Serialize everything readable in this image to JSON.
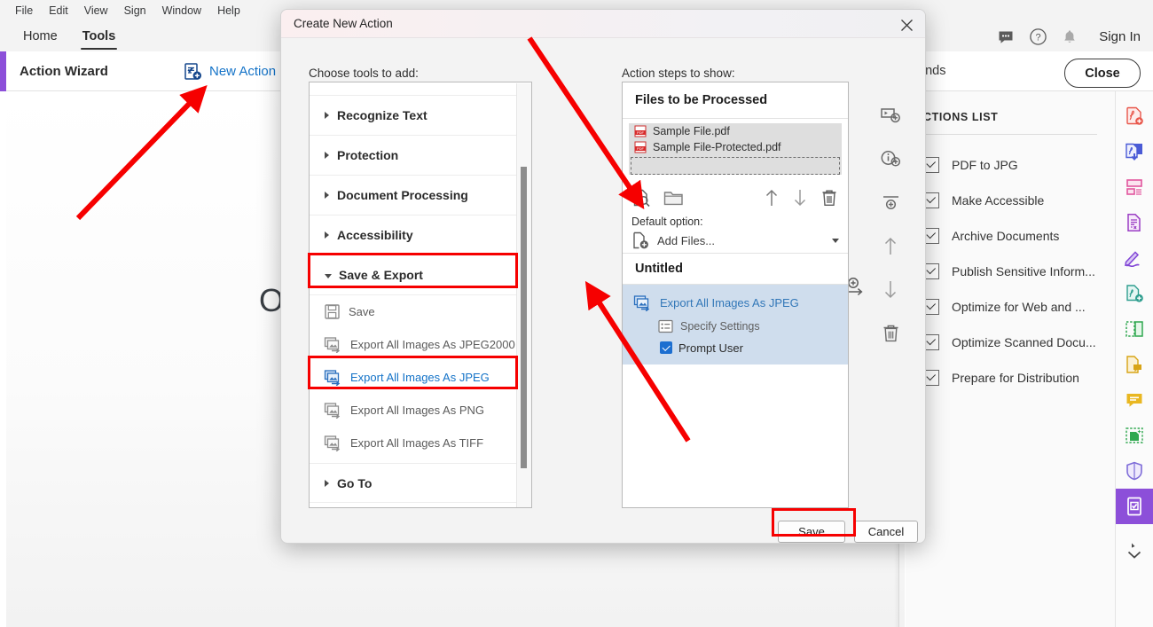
{
  "menubar": {
    "items": [
      "File",
      "Edit",
      "View",
      "Sign",
      "Window",
      "Help"
    ]
  },
  "tabs": [
    {
      "label": "Home",
      "active": false
    },
    {
      "label": "Tools",
      "active": true
    }
  ],
  "topright": {
    "comment_icon": "comment-icon",
    "help_icon": "help-icon",
    "bell_icon": "notifications-icon",
    "signin_label": "Sign In"
  },
  "command_strip": {
    "tool_title": "Action Wizard",
    "new_action_label": "New Action",
    "new_action_icon": "new-action-icon",
    "commands_text": "ands",
    "close_label": "Close"
  },
  "document": {
    "visible_text": "Op"
  },
  "actions_panel": {
    "heading": "CTIONS LIST",
    "items": [
      {
        "label": "PDF to JPG",
        "checked": true
      },
      {
        "label": "Make Accessible",
        "checked": true
      },
      {
        "label": "Archive Documents",
        "checked": true
      },
      {
        "label": "Publish Sensitive Inform...",
        "checked": true
      },
      {
        "label": "Optimize for Web and ...",
        "checked": true
      },
      {
        "label": "Optimize Scanned Docu...",
        "checked": true
      },
      {
        "label": "Prepare for Distribution",
        "checked": true
      }
    ]
  },
  "right_rail": {
    "items": [
      {
        "icon": "create-pdf-icon",
        "color": "#e8564a",
        "selected": false
      },
      {
        "icon": "export-pdf-icon",
        "color": "#4a5bd6",
        "selected": false
      },
      {
        "icon": "organize-pages-icon",
        "color": "#e2569e",
        "selected": false
      },
      {
        "icon": "edit-pdf-icon",
        "color": "#9b3fc4",
        "selected": false
      },
      {
        "icon": "fill-and-sign-icon",
        "color": "#8246d6",
        "selected": false
      },
      {
        "icon": "create-pdf-green-icon",
        "color": "#2f9e8f",
        "selected": false
      },
      {
        "icon": "compare-files-icon",
        "color": "#2fa84f",
        "selected": false
      },
      {
        "icon": "add-comment-icon",
        "color": "#d8a416",
        "selected": false
      },
      {
        "icon": "comment-bubble-icon",
        "color": "#d8a416",
        "selected": false
      },
      {
        "icon": "scan-and-ocr-icon",
        "color": "#2fa84f",
        "selected": false
      },
      {
        "icon": "protect-shield-icon",
        "color": "#7d6bd8",
        "selected": false
      },
      {
        "icon": "action-wizard-icon",
        "color": "#ffffff",
        "selected": true
      },
      {
        "icon": "chevron-down-icon",
        "color": "#4a4a4a",
        "selected": false
      }
    ]
  },
  "modal": {
    "title": "Create New Action",
    "close_icon": "close-icon",
    "left_label": "Choose tools to add:",
    "right_label": "Action steps to show:",
    "add_step_icon": "add-step-arrow-icon",
    "tool_categories": [
      {
        "name": "Recognize Text",
        "expanded": false,
        "highlighted": false
      },
      {
        "name": "Protection",
        "expanded": false,
        "highlighted": false
      },
      {
        "name": "Document Processing",
        "expanded": false,
        "highlighted": false
      },
      {
        "name": "Accessibility",
        "expanded": false,
        "highlighted": false
      },
      {
        "name": "Save & Export",
        "expanded": true,
        "highlighted": true
      },
      {
        "name": "Go To",
        "expanded": false,
        "highlighted": false
      }
    ],
    "save_export_items": [
      {
        "label": "Save",
        "icon": "save-disk-icon",
        "selected": false,
        "highlighted": false
      },
      {
        "label": "Export All Images As JPEG2000",
        "icon": "export-images-icon",
        "selected": false,
        "highlighted": false
      },
      {
        "label": "Export All Images As JPEG",
        "icon": "export-images-icon",
        "selected": true,
        "highlighted": true
      },
      {
        "label": "Export All Images As PNG",
        "icon": "export-images-icon",
        "selected": false,
        "highlighted": false
      },
      {
        "label": "Export All Images As TIFF",
        "icon": "export-images-icon",
        "selected": false,
        "highlighted": false
      }
    ],
    "files_section": {
      "header": "Files to be Processed",
      "files": [
        {
          "name": "Sample File.pdf",
          "icon": "pdf-file-icon"
        },
        {
          "name": "Sample File-Protected.pdf",
          "icon": "pdf-file-icon"
        }
      ],
      "toolbar_icons": [
        "preview-file-icon",
        "add-folder-icon",
        "move-up-arrow-icon",
        "move-down-arrow-icon",
        "delete-trash-icon"
      ],
      "default_option_label": "Default option:",
      "default_option_value": "Add Files...",
      "default_option_icon": "add-file-icon"
    },
    "steps_section": {
      "header": "Untitled",
      "step": {
        "label": "Export All Images As JPEG",
        "icon": "export-images-icon",
        "sub_label": "Specify Settings",
        "sub_icon": "settings-list-icon",
        "prompt_user_label": "Prompt User",
        "prompt_user_checked": true
      }
    },
    "side_tools": [
      {
        "icon": "add-panel-icon"
      },
      {
        "icon": "add-instruction-icon"
      },
      {
        "icon": "add-divider-icon"
      },
      {
        "icon": "move-up-arrow-icon"
      },
      {
        "icon": "move-down-arrow-icon"
      },
      {
        "icon": "delete-trash-icon"
      }
    ],
    "footer": {
      "save_label": "Save",
      "cancel_label": "Cancel"
    }
  },
  "annotations": {
    "highlight_color": "#f60000",
    "arrow_color": "#f60000",
    "arrows": [
      {
        "name": "arrow-to-new-action"
      },
      {
        "name": "arrow-to-files-list"
      },
      {
        "name": "arrow-to-step-list"
      }
    ],
    "highlights": [
      {
        "name": "highlight-save-export"
      },
      {
        "name": "highlight-export-jpeg"
      },
      {
        "name": "highlight-save-button"
      }
    ]
  }
}
